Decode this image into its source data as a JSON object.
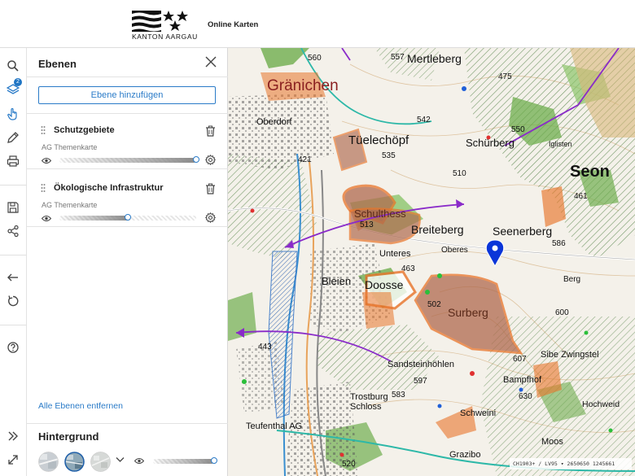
{
  "header": {
    "logo_text": "KANTON AARGAU",
    "app_title": "Online Karten"
  },
  "toolbar": {
    "items": [
      {
        "name": "search-icon",
        "label": "search"
      },
      {
        "name": "layers-icon",
        "label": "layers",
        "badge": "2"
      },
      {
        "name": "hand-pointer-icon",
        "label": "identify"
      },
      {
        "name": "pencil-icon",
        "label": "draw"
      },
      {
        "name": "printer-icon",
        "label": "print"
      },
      {
        "name": "floppy-disk-icon",
        "label": "save"
      },
      {
        "name": "share-icon",
        "label": "share"
      },
      {
        "name": "arrow-left-icon",
        "label": "back"
      },
      {
        "name": "rotate-icon",
        "label": "reset"
      },
      {
        "name": "help-icon",
        "label": "help"
      },
      {
        "name": "chevrons-right-icon",
        "label": "expand"
      },
      {
        "name": "fullscreen-icon",
        "label": "fullscreen"
      }
    ]
  },
  "panel": {
    "title": "Ebenen",
    "add_layer_label": "Ebene hinzufügen",
    "remove_all_label": "Alle Ebenen entfernen",
    "layers": [
      {
        "name": "Schutzgebiete",
        "source": "AG Themenkarte",
        "opacity": 1.0
      },
      {
        "name": "Ökologische Infrastruktur",
        "source": "AG Themenkarte",
        "opacity": 0.5
      }
    ],
    "background": {
      "title": "Hintergrund",
      "opacity": 1.0
    }
  },
  "map": {
    "coords_text": "CH1903+ / LV95 ▾  2650650 1245661",
    "labels": [
      {
        "text": "Mertleberg"
      },
      {
        "text": "Tüelechöpf"
      },
      {
        "text": "Schürberg"
      },
      {
        "text": "Seon"
      },
      {
        "text": "Schulthess"
      },
      {
        "text": "Breiteberg"
      },
      {
        "text": "Seenerberg"
      },
      {
        "text": "Doosse"
      },
      {
        "text": "Surberg"
      },
      {
        "text": "Bleien"
      },
      {
        "text": "Oberdorf"
      },
      {
        "text": "Gränichen"
      },
      {
        "text": "Sandsteinhöhlen"
      },
      {
        "text": "Trostburg"
      },
      {
        "text": "Schloss"
      },
      {
        "text": "Bampfhof"
      },
      {
        "text": "Hochweid"
      },
      {
        "text": "Sibe Zwingstel"
      },
      {
        "text": "Teufenthal AG"
      },
      {
        "text": "Schweini"
      },
      {
        "text": "Moos"
      },
      {
        "text": "Grazibo"
      },
      {
        "text": "Unteres"
      },
      {
        "text": "Oberes"
      },
      {
        "text": "Berg"
      },
      {
        "text": "Iglisten"
      },
      {
        "text": "557"
      },
      {
        "text": "542"
      },
      {
        "text": "535"
      },
      {
        "text": "550"
      },
      {
        "text": "510"
      },
      {
        "text": "421"
      },
      {
        "text": "513"
      },
      {
        "text": "586"
      },
      {
        "text": "607"
      },
      {
        "text": "597"
      },
      {
        "text": "583"
      },
      {
        "text": "630"
      },
      {
        "text": "520"
      },
      {
        "text": "560"
      },
      {
        "text": "475"
      },
      {
        "text": "461"
      },
      {
        "text": "463"
      },
      {
        "text": "443"
      },
      {
        "text": "502"
      },
      {
        "text": "600"
      }
    ],
    "colors": {
      "protected_hatch": "#5a8c4a",
      "eco_orange": "#e8742a",
      "eco_brown": "#b06a4e",
      "wildlife_corridor": "#8a2bc9",
      "water_blue": "#3a78c8",
      "forest_green": "#6fae4e",
      "marker": "#0a35d8"
    }
  }
}
